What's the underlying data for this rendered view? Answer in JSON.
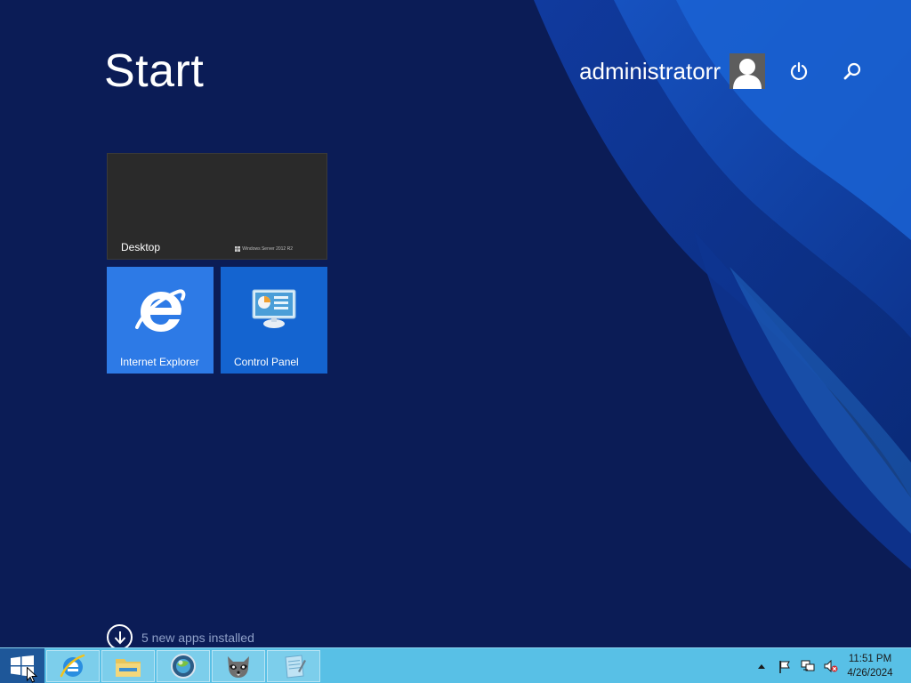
{
  "start": {
    "title": "Start"
  },
  "user": {
    "name": "administratorr"
  },
  "tiles": [
    {
      "label": "Desktop",
      "os_mark": "Windows Server 2012 R2"
    },
    {
      "label": "Internet Explorer"
    },
    {
      "label": "Control Panel"
    }
  ],
  "notification": {
    "text": "5 new apps installed"
  },
  "taskbar": {
    "pinned": [
      {
        "name": "internet-explorer"
      },
      {
        "name": "file-explorer"
      },
      {
        "name": "browser-globe"
      },
      {
        "name": "raccoon-app"
      },
      {
        "name": "notepad"
      }
    ]
  },
  "clock": {
    "time": "11:51 PM",
    "date": "4/26/2024"
  },
  "colors": {
    "background": "#0b1c56",
    "taskbar": "#58c0e6",
    "ie_tile": "#2d7ae6",
    "control_panel_tile": "#1464d0",
    "desktop_tile": "#2a2a2a"
  }
}
